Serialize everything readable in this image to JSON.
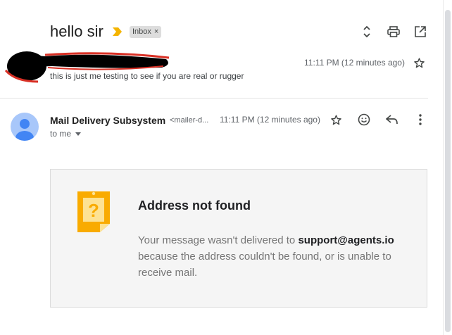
{
  "thread": {
    "subject": "hello sir",
    "label": "Inbox",
    "label_remove": "×"
  },
  "collapsed_message": {
    "snippet": "this is just me testing to see if you are real or rugger",
    "time": "11:11 PM (12 minutes ago)"
  },
  "expanded_message": {
    "sender_name": "Mail Delivery Subsystem",
    "sender_email": "<mailer-d...",
    "time": "11:11 PM (12 minutes ago)",
    "recipient": "to me"
  },
  "bounce": {
    "title": "Address not found",
    "text_before": "Your message wasn't delivered to ",
    "address": "support@agents.io",
    "text_after": " because the address couldn't be found, or is unable to receive mail."
  },
  "colors": {
    "importance_marker": "#f4b400",
    "avatar_bg": "#a8c7fa",
    "avatar_fg": "#4285f4",
    "bounce_icon": "#f9ab00",
    "redaction_black": "#000000",
    "redaction_red": "#d93025"
  },
  "icons": [
    "importance-icon",
    "expand-all-icon",
    "print-icon",
    "open-in-new-window-icon",
    "star-icon",
    "emoji-icon",
    "reply-icon",
    "more-options-icon",
    "dropdown-caret-icon",
    "error-document-icon",
    "avatar-icon"
  ]
}
